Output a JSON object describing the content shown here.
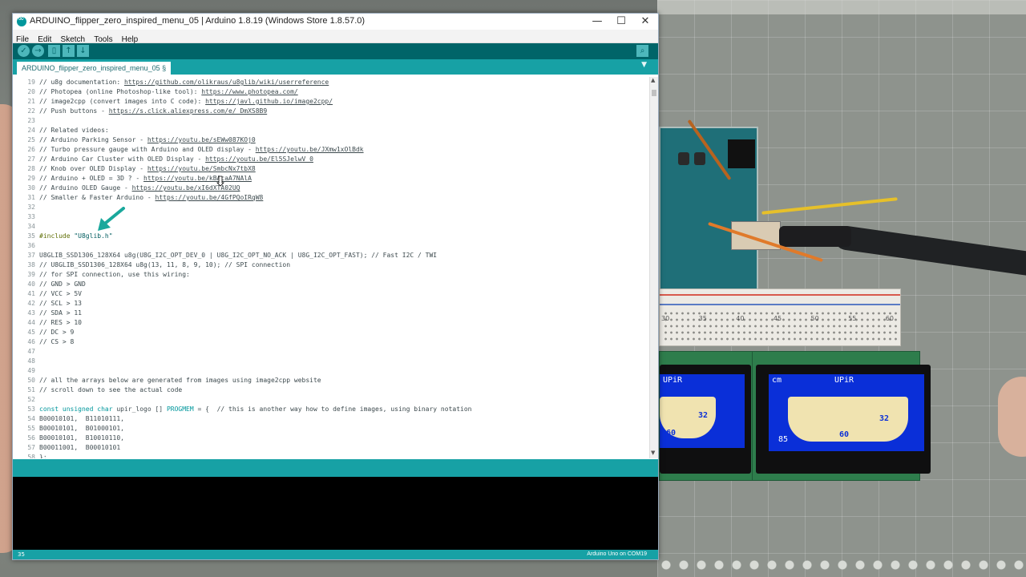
{
  "window": {
    "title": "ARDUINO_flipper_zero_inspired_menu_05 | Arduino 1.8.19 (Windows Store 1.8.57.0)",
    "controls": {
      "minimize": "—",
      "maximize": "☐",
      "close": "✕"
    }
  },
  "menubar": {
    "items": [
      "File",
      "Edit",
      "Sketch",
      "Tools",
      "Help"
    ]
  },
  "toolbar": {
    "verify_icon": "check-icon",
    "upload_icon": "arrow-right-icon",
    "new_icon": "file-icon",
    "open_icon": "arrow-up-icon",
    "save_icon": "arrow-down-icon",
    "serial_monitor_icon": "magnifier-icon"
  },
  "tab": {
    "label": "ARDUINO_flipper_zero_inspired_menu_05 §",
    "menu_glyph": "▼"
  },
  "editor": {
    "lines": [
      {
        "n": "19",
        "parts": [
          [
            "c",
            "// u8g documentation: "
          ],
          [
            "u",
            "https://github.com/olikraus/u8glib/wiki/userreference"
          ]
        ]
      },
      {
        "n": "20",
        "parts": [
          [
            "c",
            "// Photopea (online Photoshop-like tool): "
          ],
          [
            "u",
            "https://www.photopea.com/"
          ]
        ]
      },
      {
        "n": "21",
        "parts": [
          [
            "c",
            "// image2cpp (convert images into C code): "
          ],
          [
            "u",
            "https://javl.github.io/image2cpp/"
          ]
        ]
      },
      {
        "n": "22",
        "parts": [
          [
            "c",
            "// Push buttons - "
          ],
          [
            "u",
            "https://s.click.aliexpress.com/e/_DmXS8B9"
          ]
        ]
      },
      {
        "n": "23",
        "parts": []
      },
      {
        "n": "24",
        "parts": [
          [
            "c",
            "// Related videos:"
          ]
        ]
      },
      {
        "n": "25",
        "parts": [
          [
            "c",
            "// Arduino Parking Sensor - "
          ],
          [
            "u",
            "https://youtu.be/sEWw087KOj0"
          ]
        ]
      },
      {
        "n": "26",
        "parts": [
          [
            "c",
            "// Turbo pressure gauge with Arduino and OLED display - "
          ],
          [
            "u",
            "https://youtu.be/JXmw1xOlBdk"
          ]
        ]
      },
      {
        "n": "27",
        "parts": [
          [
            "c",
            "// Arduino Car Cluster with OLED Display - "
          ],
          [
            "u",
            "https://youtu.be/El5SJelwV_0"
          ]
        ]
      },
      {
        "n": "28",
        "parts": [
          [
            "c",
            "// Knob over OLED Display - "
          ],
          [
            "u",
            "https://youtu.be/SmbcNx7tbX8"
          ]
        ]
      },
      {
        "n": "29",
        "parts": [
          [
            "c",
            "// Arduino + OLED = 3D ? - "
          ],
          [
            "u",
            "https://youtu.be/kBAcaA7NAlA"
          ]
        ]
      },
      {
        "n": "30",
        "parts": [
          [
            "c",
            "// Arduino OLED Gauge - "
          ],
          [
            "u",
            "https://youtu.be/xI6dXTA02UQ"
          ]
        ]
      },
      {
        "n": "31",
        "parts": [
          [
            "c",
            "// Smaller & Faster Arduino - "
          ],
          [
            "u",
            "https://youtu.be/4GfPQoIRqW8"
          ]
        ]
      },
      {
        "n": "32",
        "parts": []
      },
      {
        "n": "33",
        "parts": []
      },
      {
        "n": "34",
        "parts": []
      },
      {
        "n": "35",
        "parts": [
          [
            "pp",
            "#include "
          ],
          [
            "str",
            "\"U8glib.h\""
          ]
        ]
      },
      {
        "n": "36",
        "parts": []
      },
      {
        "n": "37",
        "parts": [
          [
            "t",
            "U8GLIB_SSD1306_128X64 u8g(U8G_I2C_OPT_DEV_0 | U8G_I2C_OPT_NO_ACK | U8G_I2C_OPT_FAST); "
          ],
          [
            "c",
            "// Fast I2C / TWI"
          ]
        ]
      },
      {
        "n": "38",
        "parts": [
          [
            "c",
            "// U8GLIB_SSD1306_128X64 u8g(13, 11, 8, 9, 10); // SPI connection"
          ]
        ]
      },
      {
        "n": "39",
        "parts": [
          [
            "c",
            "// for SPI connection, use this wiring:"
          ]
        ]
      },
      {
        "n": "40",
        "parts": [
          [
            "c",
            "// GND > GND"
          ]
        ]
      },
      {
        "n": "41",
        "parts": [
          [
            "c",
            "// VCC > 5V"
          ]
        ]
      },
      {
        "n": "42",
        "parts": [
          [
            "c",
            "// SCL > 13"
          ]
        ]
      },
      {
        "n": "43",
        "parts": [
          [
            "c",
            "// SDA > 11"
          ]
        ]
      },
      {
        "n": "44",
        "parts": [
          [
            "c",
            "// RES > 10"
          ]
        ]
      },
      {
        "n": "45",
        "parts": [
          [
            "c",
            "// DC > 9"
          ]
        ]
      },
      {
        "n": "46",
        "parts": [
          [
            "c",
            "// CS > 8"
          ]
        ]
      },
      {
        "n": "47",
        "parts": []
      },
      {
        "n": "48",
        "parts": []
      },
      {
        "n": "49",
        "parts": []
      },
      {
        "n": "50",
        "parts": [
          [
            "c",
            "// all the arrays below are generated from images using image2cpp website"
          ]
        ]
      },
      {
        "n": "51",
        "parts": [
          [
            "c",
            "// scroll down to see the actual code"
          ]
        ]
      },
      {
        "n": "52",
        "parts": []
      },
      {
        "n": "53",
        "parts": [
          [
            "kw",
            "const unsigned char "
          ],
          [
            "t",
            "upir_logo [] "
          ],
          [
            "kw",
            "PROGMEM"
          ],
          [
            "t",
            " = {  "
          ],
          [
            "c",
            "// this is another way how to define images, using binary notation"
          ]
        ]
      },
      {
        "n": "54",
        "parts": [
          [
            "t",
            "B00010101,  B11010111,"
          ]
        ]
      },
      {
        "n": "55",
        "parts": [
          [
            "t",
            "B00010101,  B01000101,"
          ]
        ]
      },
      {
        "n": "56",
        "parts": [
          [
            "t",
            "B00010101,  B10010110,"
          ]
        ]
      },
      {
        "n": "57",
        "parts": [
          [
            "t",
            "B00011001,  B00010101"
          ]
        ]
      },
      {
        "n": "58",
        "parts": [
          [
            "t",
            "};"
          ]
        ]
      }
    ]
  },
  "footer": {
    "line_number": "35",
    "board": "Arduino Uno on COM19"
  },
  "oled_left": {
    "title": "UPiR",
    "value_a": "60",
    "value_b": "32"
  },
  "oled_right": {
    "left_label": "cm",
    "title": "UPiR",
    "value_a": "85",
    "value_b": "60",
    "value_c": "32"
  },
  "breadboard": {
    "numbers": [
      "30",
      "35",
      "40",
      "45",
      "50",
      "55",
      "60"
    ]
  },
  "colors": {
    "accent_dark": "#006468",
    "accent": "#17a1a5",
    "arrow": "#1aa89c"
  }
}
